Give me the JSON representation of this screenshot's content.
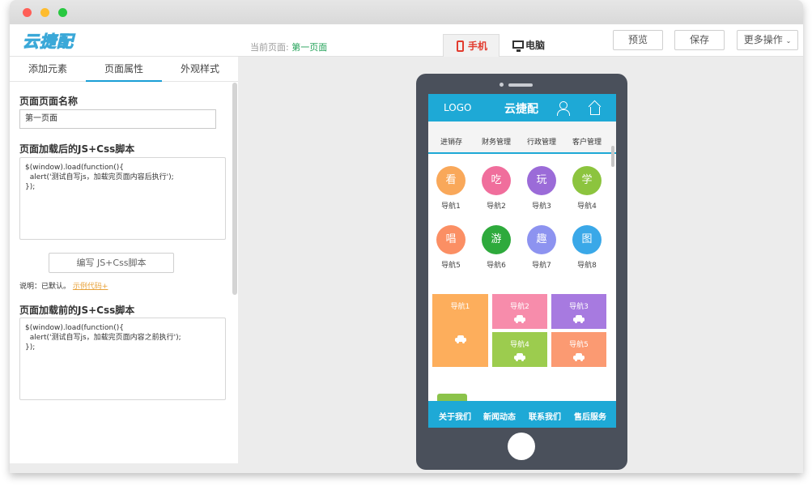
{
  "window": {
    "traffic_lights": [
      "#ff5f57",
      "#febc2e",
      "#28c840"
    ]
  },
  "header": {
    "logo_text": "云捷配",
    "current_page_label": "当前页面:",
    "current_page_value": "第一页面",
    "device_tabs": [
      {
        "label": "手机",
        "icon": "phone-icon",
        "active": true
      },
      {
        "label": "电脑",
        "icon": "desktop-icon",
        "active": false
      }
    ],
    "preview_label": "预览",
    "save_label": "保存",
    "more_label": "更多操作"
  },
  "left_panel": {
    "tabs": [
      {
        "label": "添加元素",
        "active": false
      },
      {
        "label": "页面属性",
        "active": true
      },
      {
        "label": "外观样式",
        "active": false
      }
    ],
    "page_name_title": "页面页面名称",
    "page_name_value": "第一页面",
    "after_load_title": "页面加载后的JS+Css脚本",
    "after_load_code": "$(window).load(function(){\n  alert('测试自写js，加载完页面内容后执行');\n});",
    "edit_button_label": "编写 JS+Css脚本",
    "note_text": "说明：已默认。",
    "note_link": "示例代码+",
    "before_load_title": "页面加载前的JS+Css脚本",
    "before_load_code": "$(window).load(function(){\n  alert('测试自写js，加载完页面内容之前执行');\n});"
  },
  "phone_screen": {
    "logo": "LOGO",
    "title": "云捷配",
    "menu": [
      "进销存",
      "财务管理",
      "行政管理",
      "客户管理"
    ],
    "grid": [
      {
        "char": "看",
        "label": "导航1",
        "color": "#f9a85a"
      },
      {
        "char": "吃",
        "label": "导航2",
        "color": "#f06e9c"
      },
      {
        "char": "玩",
        "label": "导航3",
        "color": "#9b6bd8"
      },
      {
        "char": "学",
        "label": "导航4",
        "color": "#8cc43e"
      },
      {
        "char": "唱",
        "label": "导航5",
        "color": "#fb8f64"
      },
      {
        "char": "游",
        "label": "导航6",
        "color": "#2eaa3c"
      },
      {
        "char": "趣",
        "label": "导航7",
        "color": "#8d93f0"
      },
      {
        "char": "图",
        "label": "导航8",
        "color": "#3aa8e8"
      }
    ],
    "tiles": [
      {
        "label": "导航1",
        "color": "#fdae5c"
      },
      {
        "label": "导航2",
        "color": "#f78cab"
      },
      {
        "label": "导航3",
        "color": "#a77ae0"
      },
      {
        "label": "导航4",
        "color": "#9ccc4e"
      },
      {
        "label": "导航5",
        "color": "#fb9a72"
      }
    ],
    "footer": [
      "关于我们",
      "新闻动态",
      "联系我们",
      "售后服务"
    ]
  }
}
